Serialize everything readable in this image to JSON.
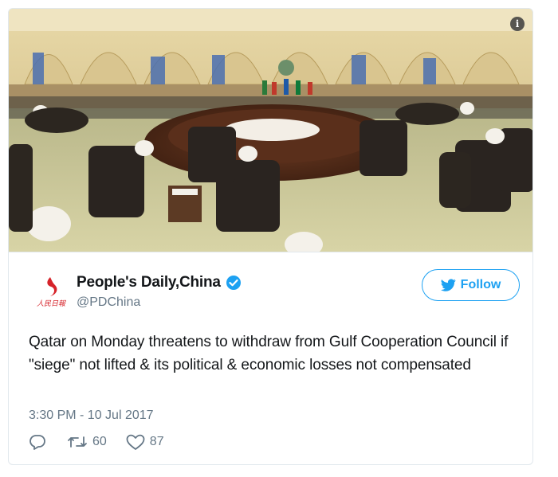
{
  "tweet": {
    "author_name": "People's Daily,China",
    "handle": "@PDChina",
    "follow_label": "Follow",
    "text": "Qatar on Monday threatens to withdraw from Gulf Cooperation Council if \"siege\" not lifted & its political & economic losses not compensated",
    "timestamp": "3:30 PM - 10 Jul 2017",
    "retweet_count": "60",
    "like_count": "87",
    "logo_glyph": "人民日報"
  },
  "media": {
    "info_glyph": "i"
  },
  "colors": {
    "accent": "#1da1f2",
    "muted": "#657786",
    "logo_red": "#d6232a"
  },
  "icons": {
    "info": "info-icon",
    "verified": "verified-badge-icon",
    "bird": "twitter-bird-icon",
    "reply": "reply-icon",
    "retweet": "retweet-icon",
    "like": "heart-icon"
  }
}
